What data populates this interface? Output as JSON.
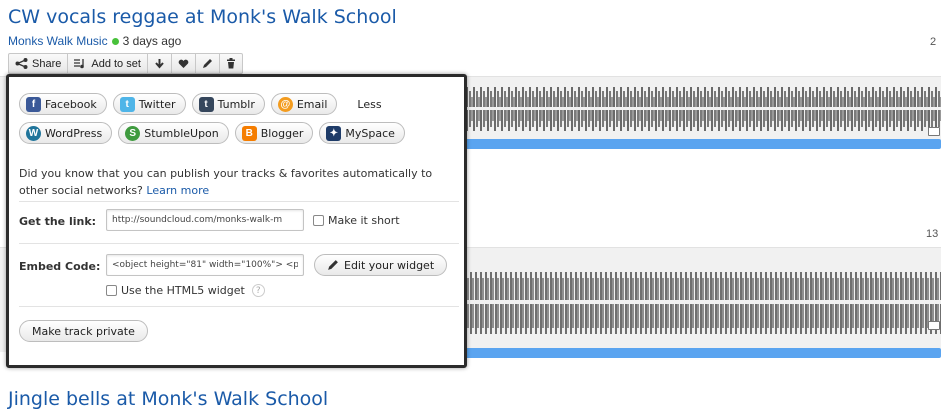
{
  "track1": {
    "title": "CW vocals reggae at Monk's Walk School",
    "user": "Monks Walk Music",
    "age": "3 days ago",
    "count": "2"
  },
  "toolbar": {
    "share_label": "Share",
    "add_to_set_label": "Add to set"
  },
  "share": {
    "buttons_row1": [
      "Facebook",
      "Twitter",
      "Tumblr",
      "Email"
    ],
    "less_label": "Less",
    "buttons_row2": [
      "WordPress",
      "StumbleUpon",
      "Blogger",
      "MySpace"
    ],
    "info_text": "Did you know that you can publish your tracks & favorites automatically to other social networks?",
    "learn_more": "Learn more",
    "link_label": "Get the link:",
    "link_value": "http://soundcloud.com/monks-walk-m",
    "make_short_label": "Make it short",
    "embed_label": "Embed Code:",
    "embed_value": "<object height=\"81\" width=\"100%\"> <p",
    "edit_widget_label": "Edit your widget",
    "html5_label": "Use the HTML5 widget",
    "help_glyph": "?",
    "private_label": "Make track private"
  },
  "track2": {
    "count": "13"
  },
  "track3": {
    "title": "Jingle bells at Monk's Walk School"
  },
  "colors": {
    "title_blue": "#1a5aa8",
    "progress_blue": "#5aa4f0",
    "online_green": "#48c13a",
    "facebook": "#3b5998",
    "twitter": "#4fb5e8",
    "tumblr": "#35465c",
    "email": "#f39c1f",
    "wordpress": "#21759b",
    "stumbleupon": "#3f9b3f",
    "blogger": "#f57d00",
    "myspace": "#1e3b68"
  }
}
